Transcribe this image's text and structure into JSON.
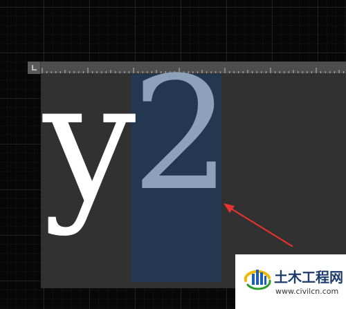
{
  "canvas": {
    "glyph_left": "y",
    "glyph_right": "2",
    "text_color": "#ffffff",
    "selected_text_color": "#8ea1bb",
    "selection_color": "#233750",
    "frame_color": "#313131"
  },
  "annotation": {
    "arrow_color": "#e8322f",
    "arrow_icon": "red-arrow-icon"
  },
  "watermark": {
    "title": "土木工程网",
    "url": "www.civilcn.com",
    "logo_icon": "civilcn-logo-icon",
    "brand_color": "#1d3c6b"
  }
}
